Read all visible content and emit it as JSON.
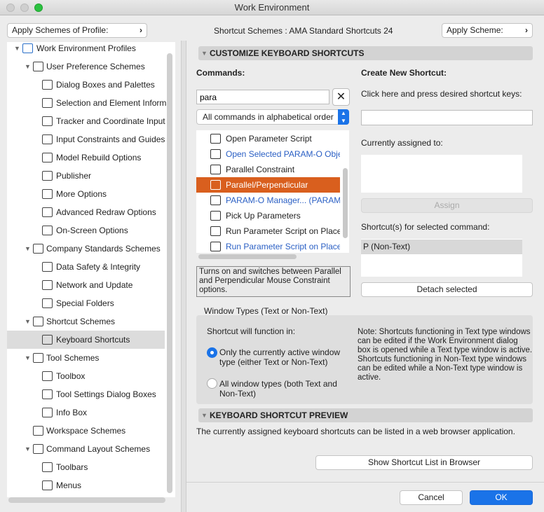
{
  "window": {
    "title": "Work Environment"
  },
  "toolbar": {
    "apply_profile": "Apply Schemes of Profile:",
    "scheme_label": "Shortcut Schemes : AMA Standard Shortcuts 24",
    "apply_scheme": "Apply Scheme:"
  },
  "tree": [
    {
      "label": "Work Environment Profiles",
      "level": 0,
      "expanded": true
    },
    {
      "label": "User Preference Schemes",
      "level": 1,
      "expanded": true
    },
    {
      "label": "Dialog Boxes and Palettes",
      "level": 2
    },
    {
      "label": "Selection and Element Informa",
      "level": 2
    },
    {
      "label": "Tracker and Coordinate Input",
      "level": 2
    },
    {
      "label": "Input Constraints and Guides",
      "level": 2
    },
    {
      "label": "Model Rebuild Options",
      "level": 2
    },
    {
      "label": "Publisher",
      "level": 2
    },
    {
      "label": "More Options",
      "level": 2
    },
    {
      "label": "Advanced Redraw Options",
      "level": 2
    },
    {
      "label": "On-Screen Options",
      "level": 2
    },
    {
      "label": "Company Standards Schemes",
      "level": 1,
      "expanded": true
    },
    {
      "label": "Data Safety & Integrity",
      "level": 2
    },
    {
      "label": "Network and Update",
      "level": 2
    },
    {
      "label": "Special Folders",
      "level": 2
    },
    {
      "label": "Shortcut Schemes",
      "level": 1,
      "expanded": true
    },
    {
      "label": "Keyboard Shortcuts",
      "level": 2,
      "selected": true
    },
    {
      "label": "Tool Schemes",
      "level": 1,
      "expanded": true
    },
    {
      "label": "Toolbox",
      "level": 2
    },
    {
      "label": "Tool Settings Dialog Boxes",
      "level": 2
    },
    {
      "label": "Info Box",
      "level": 2
    },
    {
      "label": "Workspace Schemes",
      "level": 1
    },
    {
      "label": "Command Layout Schemes",
      "level": 1,
      "expanded": true
    },
    {
      "label": "Toolbars",
      "level": 2
    },
    {
      "label": "Menus",
      "level": 2
    }
  ],
  "customize": {
    "header": "CUSTOMIZE KEYBOARD SHORTCUTS",
    "commands_label": "Commands:",
    "search_value": "para",
    "filter": "All commands in alphabetical order",
    "commands": [
      {
        "label": "Open Parameter Script",
        "blue": false
      },
      {
        "label": "Open Selected PARAM-O Object",
        "blue": true
      },
      {
        "label": "Parallel Constraint",
        "blue": false
      },
      {
        "label": "Parallel/Perpendicular",
        "blue": false,
        "selected": true
      },
      {
        "label": "PARAM-O Manager...  (PARAM-O)",
        "blue": true
      },
      {
        "label": "Pick Up Parameters",
        "blue": false
      },
      {
        "label": "Run Parameter Script on Placed",
        "blue": false
      },
      {
        "label": "Run Parameter Script on Placed",
        "blue": true
      }
    ],
    "description": "Turns on and switches between Parallel and Perpendicular Mouse Constraint options.",
    "create_label": "Create New Shortcut:",
    "press_hint": "Click here and press desired shortcut keys:",
    "assigned_label": "Currently assigned to:",
    "assign_button": "Assign",
    "shortcuts_label": "Shortcut(s) for selected command:",
    "shortcuts": [
      "P (Non-Text)"
    ],
    "detach_button": "Detach selected"
  },
  "window_types": {
    "label": "Window Types (Text or Non-Text)",
    "function_label": "Shortcut will function in:",
    "option1": "Only the currently active window type (either Text or Non-Text)",
    "option2": "All window types (both Text and Non-Text)",
    "selected": 1,
    "note": "Note: Shortcuts functioning in Text type windows can be edited if the Work Environment dialog box is opened while a Text type window is active. Shortcuts functioning in Non-Text type windows can be edited while a Non-Text type window is active."
  },
  "preview": {
    "header": "KEYBOARD SHORTCUT PREVIEW",
    "text": "The currently assigned keyboard shortcuts can be listed in a web browser application.",
    "button": "Show Shortcut List in Browser"
  },
  "footer": {
    "cancel": "Cancel",
    "ok": "OK"
  },
  "colors": {
    "accent": "#1a73e8",
    "selection": "#d95f1e",
    "link": "#2a5fc4"
  }
}
